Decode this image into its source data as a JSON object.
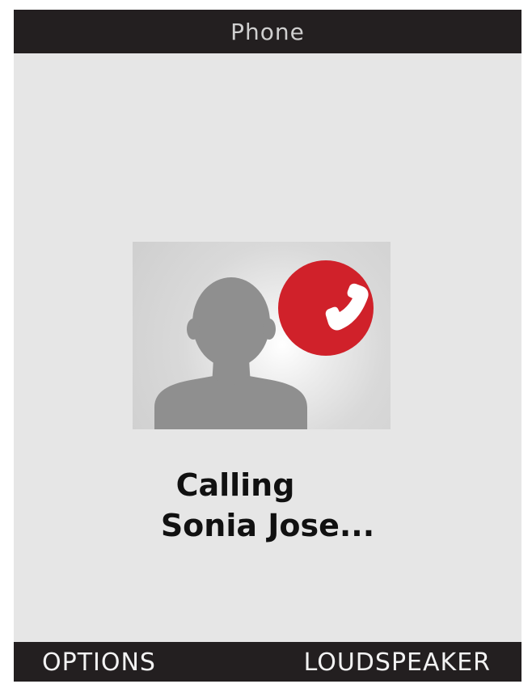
{
  "header": {
    "title": "Phone"
  },
  "contact": {
    "avatar_icon": "person-silhouette-icon",
    "call_icon": "phone-handset-icon",
    "call_badge_color": "#d0212a"
  },
  "status": {
    "line1": "Calling",
    "line2": "Sonia Jose..."
  },
  "softkeys": {
    "left_label": "OPTIONS",
    "right_label": "LOUDSPEAKER"
  },
  "colors": {
    "bar_background": "#231f20",
    "screen_background": "#e6e6e6"
  }
}
